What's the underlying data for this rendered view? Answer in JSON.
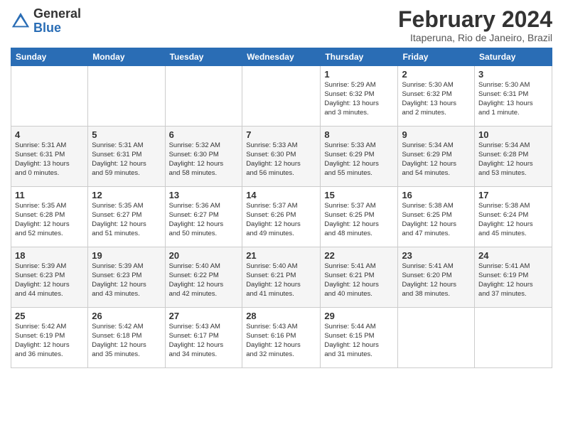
{
  "header": {
    "logo_general": "General",
    "logo_blue": "Blue",
    "month_year": "February 2024",
    "location": "Itaperuna, Rio de Janeiro, Brazil"
  },
  "weekdays": [
    "Sunday",
    "Monday",
    "Tuesday",
    "Wednesday",
    "Thursday",
    "Friday",
    "Saturday"
  ],
  "weeks": [
    [
      {
        "day": "",
        "info": ""
      },
      {
        "day": "",
        "info": ""
      },
      {
        "day": "",
        "info": ""
      },
      {
        "day": "",
        "info": ""
      },
      {
        "day": "1",
        "info": "Sunrise: 5:29 AM\nSunset: 6:32 PM\nDaylight: 13 hours\nand 3 minutes."
      },
      {
        "day": "2",
        "info": "Sunrise: 5:30 AM\nSunset: 6:32 PM\nDaylight: 13 hours\nand 2 minutes."
      },
      {
        "day": "3",
        "info": "Sunrise: 5:30 AM\nSunset: 6:31 PM\nDaylight: 13 hours\nand 1 minute."
      }
    ],
    [
      {
        "day": "4",
        "info": "Sunrise: 5:31 AM\nSunset: 6:31 PM\nDaylight: 13 hours\nand 0 minutes."
      },
      {
        "day": "5",
        "info": "Sunrise: 5:31 AM\nSunset: 6:31 PM\nDaylight: 12 hours\nand 59 minutes."
      },
      {
        "day": "6",
        "info": "Sunrise: 5:32 AM\nSunset: 6:30 PM\nDaylight: 12 hours\nand 58 minutes."
      },
      {
        "day": "7",
        "info": "Sunrise: 5:33 AM\nSunset: 6:30 PM\nDaylight: 12 hours\nand 56 minutes."
      },
      {
        "day": "8",
        "info": "Sunrise: 5:33 AM\nSunset: 6:29 PM\nDaylight: 12 hours\nand 55 minutes."
      },
      {
        "day": "9",
        "info": "Sunrise: 5:34 AM\nSunset: 6:29 PM\nDaylight: 12 hours\nand 54 minutes."
      },
      {
        "day": "10",
        "info": "Sunrise: 5:34 AM\nSunset: 6:28 PM\nDaylight: 12 hours\nand 53 minutes."
      }
    ],
    [
      {
        "day": "11",
        "info": "Sunrise: 5:35 AM\nSunset: 6:28 PM\nDaylight: 12 hours\nand 52 minutes."
      },
      {
        "day": "12",
        "info": "Sunrise: 5:35 AM\nSunset: 6:27 PM\nDaylight: 12 hours\nand 51 minutes."
      },
      {
        "day": "13",
        "info": "Sunrise: 5:36 AM\nSunset: 6:27 PM\nDaylight: 12 hours\nand 50 minutes."
      },
      {
        "day": "14",
        "info": "Sunrise: 5:37 AM\nSunset: 6:26 PM\nDaylight: 12 hours\nand 49 minutes."
      },
      {
        "day": "15",
        "info": "Sunrise: 5:37 AM\nSunset: 6:25 PM\nDaylight: 12 hours\nand 48 minutes."
      },
      {
        "day": "16",
        "info": "Sunrise: 5:38 AM\nSunset: 6:25 PM\nDaylight: 12 hours\nand 47 minutes."
      },
      {
        "day": "17",
        "info": "Sunrise: 5:38 AM\nSunset: 6:24 PM\nDaylight: 12 hours\nand 45 minutes."
      }
    ],
    [
      {
        "day": "18",
        "info": "Sunrise: 5:39 AM\nSunset: 6:23 PM\nDaylight: 12 hours\nand 44 minutes."
      },
      {
        "day": "19",
        "info": "Sunrise: 5:39 AM\nSunset: 6:23 PM\nDaylight: 12 hours\nand 43 minutes."
      },
      {
        "day": "20",
        "info": "Sunrise: 5:40 AM\nSunset: 6:22 PM\nDaylight: 12 hours\nand 42 minutes."
      },
      {
        "day": "21",
        "info": "Sunrise: 5:40 AM\nSunset: 6:21 PM\nDaylight: 12 hours\nand 41 minutes."
      },
      {
        "day": "22",
        "info": "Sunrise: 5:41 AM\nSunset: 6:21 PM\nDaylight: 12 hours\nand 40 minutes."
      },
      {
        "day": "23",
        "info": "Sunrise: 5:41 AM\nSunset: 6:20 PM\nDaylight: 12 hours\nand 38 minutes."
      },
      {
        "day": "24",
        "info": "Sunrise: 5:41 AM\nSunset: 6:19 PM\nDaylight: 12 hours\nand 37 minutes."
      }
    ],
    [
      {
        "day": "25",
        "info": "Sunrise: 5:42 AM\nSunset: 6:19 PM\nDaylight: 12 hours\nand 36 minutes."
      },
      {
        "day": "26",
        "info": "Sunrise: 5:42 AM\nSunset: 6:18 PM\nDaylight: 12 hours\nand 35 minutes."
      },
      {
        "day": "27",
        "info": "Sunrise: 5:43 AM\nSunset: 6:17 PM\nDaylight: 12 hours\nand 34 minutes."
      },
      {
        "day": "28",
        "info": "Sunrise: 5:43 AM\nSunset: 6:16 PM\nDaylight: 12 hours\nand 32 minutes."
      },
      {
        "day": "29",
        "info": "Sunrise: 5:44 AM\nSunset: 6:15 PM\nDaylight: 12 hours\nand 31 minutes."
      },
      {
        "day": "",
        "info": ""
      },
      {
        "day": "",
        "info": ""
      }
    ]
  ]
}
